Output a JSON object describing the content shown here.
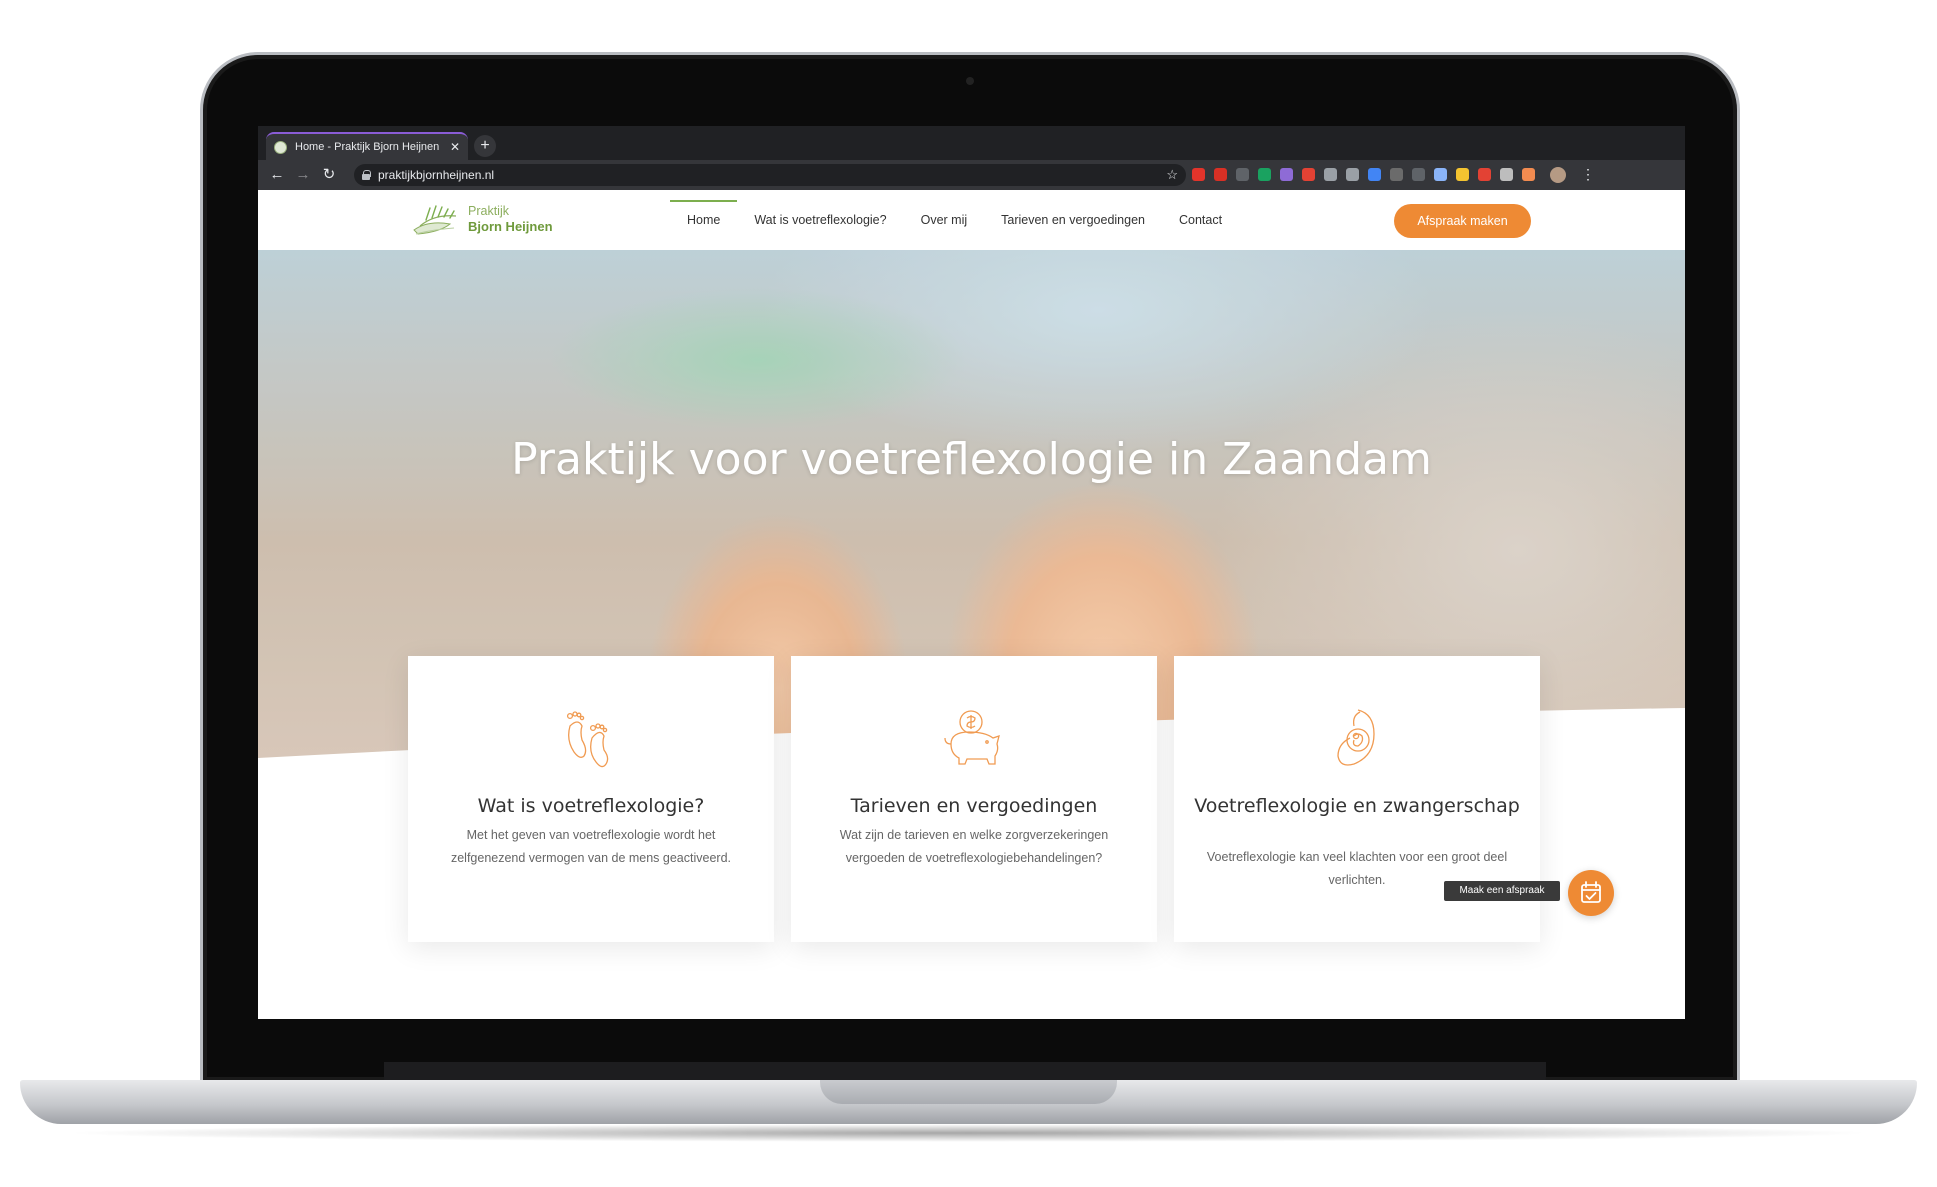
{
  "browser": {
    "tab_title": "Home - Praktijk Bjorn Heijnen",
    "tab_close": "✕",
    "new_tab": "+",
    "url": "praktijkbjornheijnen.nl",
    "back": "←",
    "forward": "→",
    "reload": "↻",
    "bookmark": "☆",
    "menu": "⋮",
    "extension_colors": [
      "#e2342b",
      "#d93025",
      "#5f6368",
      "#1aa260",
      "#8e6bd6",
      "#e34234",
      "#9aa0a6",
      "#9aa0a6",
      "#4285f4",
      "#6b6b6b",
      "#5f6368",
      "#8ab4f8",
      "#f4c430",
      "#e34234",
      "#bdbdbd",
      "#f28b50"
    ]
  },
  "site": {
    "logo_line1": "Praktijk",
    "logo_line2": "Bjorn Heijnen",
    "nav": [
      "Home",
      "Wat is voetreflexologie?",
      "Over mij",
      "Tarieven en vergoedingen",
      "Contact"
    ],
    "cta": "Afspraak maken",
    "accent_color": "#ee8a34",
    "brand_green": "#7cae4e"
  },
  "hero": {
    "title": "Praktijk voor voetreflexologie in Zaandam"
  },
  "cards": [
    {
      "icon": "feet-icon",
      "title": "Wat is voetreflexologie?",
      "text": "Met het geven van voetreflexologie wordt het zelfgenezend vermogen van de mens geactiveerd."
    },
    {
      "icon": "piggy-bank-icon",
      "title": "Tarieven en vergoedingen",
      "text": "Wat zijn de tarieven en welke zorgverzekeringen vergoeden de voetreflexologiebehandelingen?"
    },
    {
      "icon": "pregnancy-icon",
      "title": "Voetreflexologie en zwangerschap",
      "text": "Voetreflexologie kan veel klachten voor een groot deel verlichten."
    }
  ],
  "floating": {
    "label": "Maak een afspraak"
  }
}
